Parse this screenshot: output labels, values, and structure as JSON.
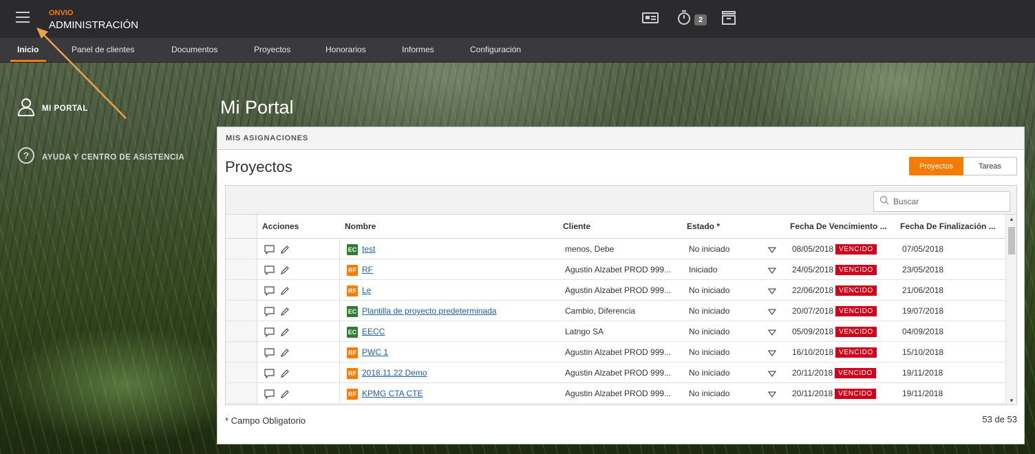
{
  "app": {
    "brand": "ONVIO",
    "module": "ADMINISTRACIÓN",
    "notification_count": "2"
  },
  "nav": [
    {
      "label": "Inicio",
      "active": true
    },
    {
      "label": "Panel de clientes"
    },
    {
      "label": "Documentos"
    },
    {
      "label": "Proyectos"
    },
    {
      "label": "Honorarios"
    },
    {
      "label": "Informes"
    },
    {
      "label": "Configuración"
    }
  ],
  "sidebar": {
    "my_portal": "MI PORTAL",
    "help": "AYUDA Y CENTRO DE ASISTENCIA"
  },
  "page": {
    "title": "Mi Portal"
  },
  "panel": {
    "header": "MIS ASIGNACIONES",
    "title": "Proyectos",
    "toggle": {
      "projects": "Proyectos",
      "tasks": "Tareas"
    },
    "search_placeholder": "Buscar",
    "columns": [
      "Acciones",
      "Nombre",
      "Cliente",
      "Estado *",
      "Fecha De Vencimiento ...",
      "Fecha De Finalización ..."
    ],
    "overdue_label": "VENCIDO",
    "rows": [
      {
        "tag": "EC",
        "name": "test",
        "client": "menos, Debe",
        "status": "No iniciado",
        "due": "08/05/2018",
        "end": "07/05/2018"
      },
      {
        "tag": "RF",
        "name": "RF",
        "client": "Agustin Alzabet PROD 999...",
        "status": "Iniciado",
        "due": "24/05/2018",
        "end": "23/05/2018"
      },
      {
        "tag": "RF",
        "name": "Le",
        "client": "Agustin Alzabet PROD 999...",
        "status": "No iniciado",
        "due": "22/06/2018",
        "end": "21/06/2018"
      },
      {
        "tag": "EC",
        "name": "Plantilla de proyecto predeterminada",
        "client": "Cambio, Diferencia",
        "status": "No iniciado",
        "due": "20/07/2018",
        "end": "19/07/2018"
      },
      {
        "tag": "EC",
        "name": "EECC",
        "client": "Latngo SA",
        "status": "No iniciado",
        "due": "05/09/2018",
        "end": "04/09/2018"
      },
      {
        "tag": "RF",
        "name": "PWC 1",
        "client": "Agustin Alzabet PROD 999...",
        "status": "No iniciado",
        "due": "16/10/2018",
        "end": "15/10/2018"
      },
      {
        "tag": "RF",
        "name": "2018.11.22 Demo",
        "client": "Agustin Alzabet PROD 999...",
        "status": "No iniciado",
        "due": "20/11/2018",
        "end": "19/11/2018"
      },
      {
        "tag": "RF",
        "name": "KPMG CTA CTE",
        "client": "Agustin Alzabet PROD 999...",
        "status": "No iniciado",
        "due": "20/11/2018",
        "end": "19/11/2018"
      }
    ],
    "footer_note": "* Campo Obligatorio",
    "count": "53 de 53"
  },
  "colors": {
    "accent": "#f07d15",
    "tag_ec": "#2e7d32",
    "tag_rf": "#f57c00",
    "overdue": "#d0021b",
    "link": "#1f5fa8"
  }
}
